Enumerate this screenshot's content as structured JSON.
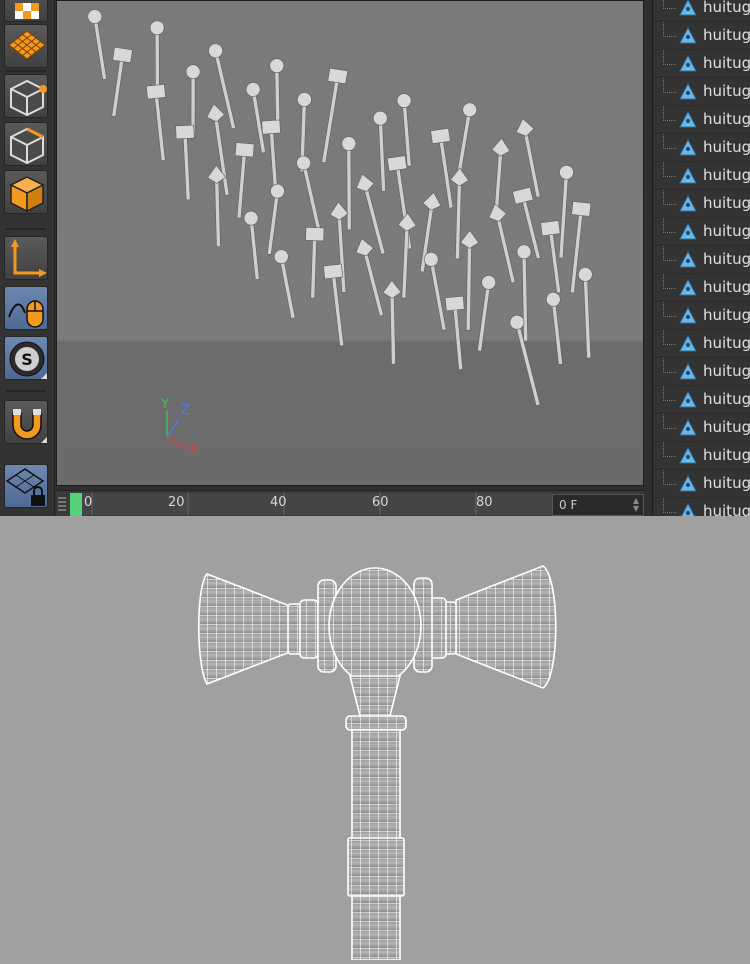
{
  "timeline": {
    "ticks": [
      "0",
      "20",
      "40",
      "60",
      "80"
    ],
    "frame": "0 F"
  },
  "axis": {
    "y": "Y",
    "z": "Z",
    "x": "X"
  },
  "outliner": {
    "items": [
      "huitug",
      "huitug",
      "huitug",
      "huitug",
      "huitug",
      "huitug",
      "huitug",
      "huitug",
      "huitug",
      "huitug",
      "huitug",
      "huitug",
      "huitug",
      "huitug",
      "huitug",
      "huitug",
      "huitug",
      "huitug",
      "huitug"
    ]
  },
  "toolbar": {
    "tools": [
      "checker-icon",
      "grid-plane-icon",
      "point-mode-icon",
      "edge-mode-icon",
      "polygon-mode-icon",
      "axis-mode-icon",
      "tweak-mouse-icon",
      "snap-icon",
      "magnet-icon",
      "workplane-lock-icon"
    ]
  },
  "colors": {
    "playhead": "#55d279",
    "axis_x": "#e04040",
    "axis_y": "#3fc24f",
    "axis_z": "#4a7df0",
    "tool_orange": "#f29a1f",
    "active_tool": "#5b79a4"
  }
}
